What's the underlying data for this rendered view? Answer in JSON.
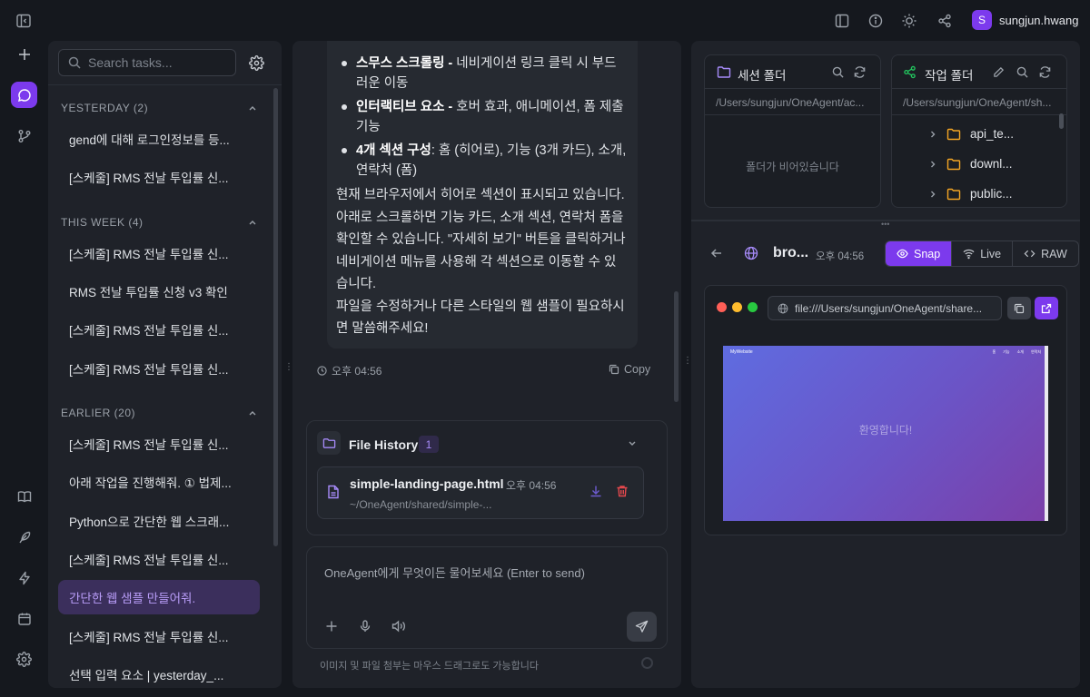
{
  "topbar": {
    "user": {
      "initial": "S",
      "name": "sungjun.hwang"
    }
  },
  "sidebar": {
    "search_placeholder": "Search tasks...",
    "groups": [
      {
        "label": "YESTERDAY (2)",
        "items": [
          "gend에 대해 로그인정보를 등...",
          "[스케줄] RMS 전날 투입률 신..."
        ]
      },
      {
        "label": "THIS WEEK (4)",
        "items": [
          "[스케줄] RMS 전날 투입률 신...",
          "RMS 전날 투입률 신청 v3 확인",
          "[스케줄] RMS 전날 투입률 신...",
          "[스케줄] RMS 전날 투입률 신..."
        ]
      },
      {
        "label": "EARLIER (20)",
        "items": [
          "[스케줄] RMS 전날 투입률 신...",
          "아래 작업을 진행해줘. ① 법제...",
          "Python으로 간단한 웹 스크래...",
          "[스케줄] RMS 전날 투입률 신...",
          "간단한 웹 샘플 만들어줘.",
          "[스케줄] RMS 전날 투입률 신...",
          "선택 입력 요소 | yesterday_..."
        ]
      }
    ]
  },
  "chat": {
    "bullets": [
      {
        "bold": "스무스 스크롤링 -",
        "text": " 네비게이션 링크 클릭 시 부드러운 이동"
      },
      {
        "bold": "인터랙티브 요소 -",
        "text": " 호버 효과, 애니메이션, 폼 제출 기능"
      },
      {
        "bold": "4개 섹션 구성",
        "text": ": 홈 (히어로), 기능 (3개 카드), 소개, 연락처 (폼)"
      }
    ],
    "paragraph": "현재 브라우저에서 히어로 섹션이 표시되고 있습니다. 아래로 스크롤하면 기능 카드, 소개 섹션, 연락처 폼을 확인할 수 있습니다. \"자세히 보기\" 버튼을 클릭하거나 네비게이션 메뉴를 사용해 각 섹션으로 이동할 수 있습니다.\n파일을 수정하거나 다른 스타일의 웹 샘플이 필요하시면 말씀해주세요!",
    "time": "오후 04:56",
    "copy_label": "Copy",
    "file_history": {
      "title": "File History",
      "count": "1",
      "file": {
        "name": "simple-landing-page.html",
        "time": "오후 04:56",
        "path": "~/OneAgent/shared/simple-..."
      }
    },
    "composer": {
      "placeholder": "OneAgent에게 무엇이든 물어보세요 (Enter to send)",
      "hint": "이미지 및 파일 첨부는 마우스 드래그로도 가능합니다"
    }
  },
  "right": {
    "session_folder": {
      "title": "세션 폴더",
      "path": "/Users/sungjun/OneAgent/ac...",
      "empty": "폴더가 비어있습니다"
    },
    "work_folder": {
      "title": "작업 폴더",
      "path": "/Users/sungjun/OneAgent/sh...",
      "items": [
        "api_te...",
        "downl...",
        "public..."
      ]
    },
    "browser": {
      "title": "bro...",
      "time": "오후 04:56",
      "modes": [
        "Snap",
        "Live",
        "RAW"
      ],
      "active_mode": "Snap",
      "url": "file:///Users/sungjun/OneAgent/share...",
      "preview_brand": "MyWebsite",
      "preview_links": [
        "홈",
        "기능",
        "소개",
        "연락처"
      ],
      "preview_hero": "환영합니다!"
    }
  },
  "colors": {
    "accent": "#7c3aed",
    "danger": "#e5484d",
    "folder": "#f5a623",
    "share": "#22c55e"
  }
}
